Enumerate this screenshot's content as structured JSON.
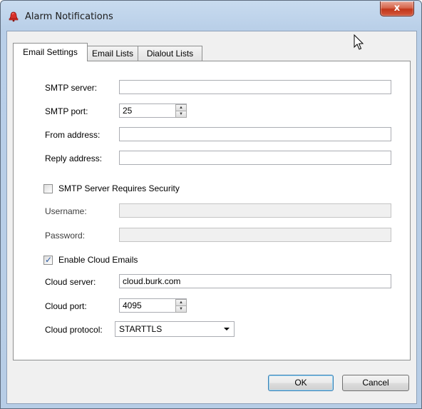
{
  "window": {
    "title": "Alarm Notifications",
    "close_glyph": "x",
    "icon": "alarm-bell-icon"
  },
  "tabs": [
    {
      "label": "Email Settings",
      "active": true
    },
    {
      "label": "Email Lists",
      "active": false
    },
    {
      "label": "Dialout Lists",
      "active": false
    }
  ],
  "email_settings": {
    "smtp_server": {
      "label": "SMTP server:",
      "value": ""
    },
    "smtp_port": {
      "label": "SMTP port:",
      "value": "25"
    },
    "from_address": {
      "label": "From address:",
      "value": ""
    },
    "reply_address": {
      "label": "Reply address:",
      "value": ""
    },
    "requires_security": {
      "label": "SMTP Server Requires Security",
      "checked": false
    },
    "username": {
      "label": "Username:",
      "value": ""
    },
    "password": {
      "label": "Password:",
      "value": ""
    },
    "enable_cloud": {
      "label": "Enable Cloud Emails",
      "checked": true
    },
    "cloud_server": {
      "label": "Cloud server:",
      "value": "cloud.burk.com"
    },
    "cloud_port": {
      "label": "Cloud port:",
      "value": "4095"
    },
    "cloud_protocol": {
      "label": "Cloud protocol:",
      "value": "STARTTLS"
    }
  },
  "buttons": {
    "ok": "OK",
    "cancel": "Cancel"
  },
  "glyphs": {
    "check": "✓",
    "spin_up": "▲",
    "spin_down": "▼"
  },
  "colors": {
    "close_button": "#c2371a",
    "title_bar": "#b9cfe8",
    "checkmark": "#2d5aa0"
  }
}
